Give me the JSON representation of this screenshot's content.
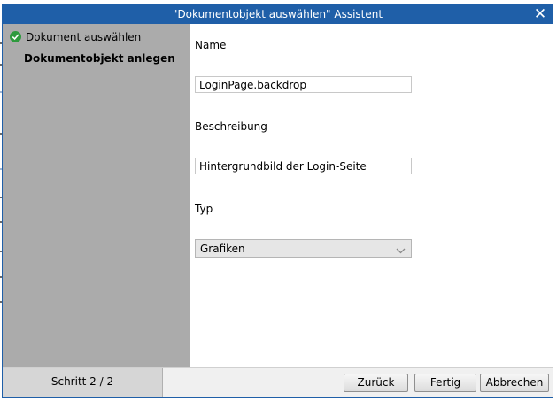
{
  "dialog": {
    "title": "\"Dokumentobjekt auswählen\" Assistent",
    "close_glyph": "✕"
  },
  "steps": [
    {
      "label": "Dokument auswählen",
      "status": "done",
      "icon": "check-circle-icon"
    },
    {
      "label": "Dokumentobjekt anlegen",
      "status": "current"
    }
  ],
  "form": {
    "name": {
      "label": "Name",
      "value": "LoginPage.backdrop"
    },
    "description": {
      "label": "Beschreibung",
      "value": "Hintergrundbild der Login-Seite"
    },
    "type": {
      "label": "Typ",
      "value": "Grafiken"
    }
  },
  "footer": {
    "step_counter": "Schritt 2 / 2",
    "back_button": "Zurück",
    "finish_button": "Fertig",
    "cancel_button": "Abbrechen"
  },
  "colors": {
    "titlebar": "#1f5fa8",
    "sidebar": "#ababab",
    "check": "#2e9a3e"
  }
}
